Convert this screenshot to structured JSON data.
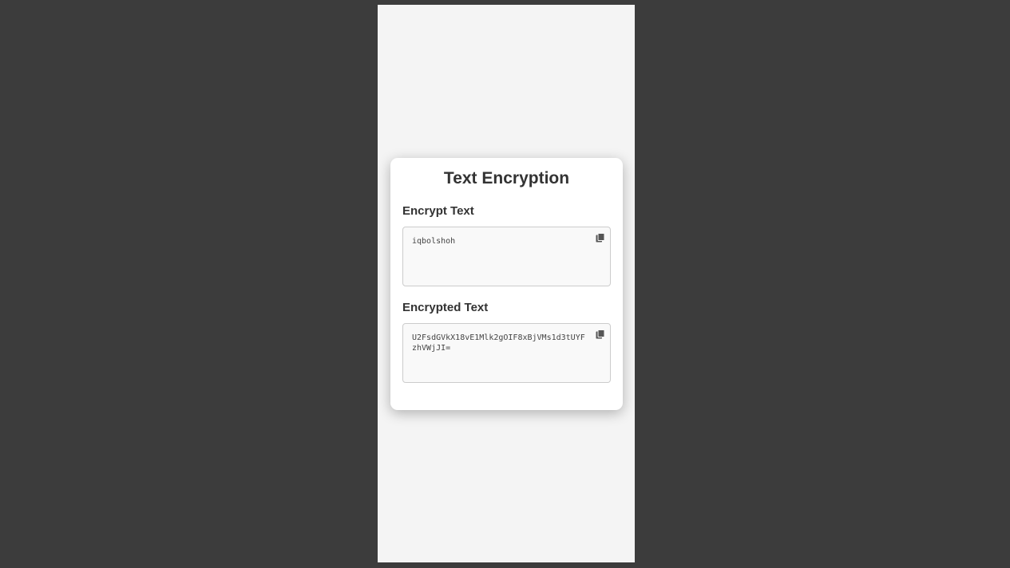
{
  "app": {
    "title": "Text Encryption"
  },
  "encrypt_section": {
    "label": "Encrypt Text",
    "input_value": "iqbolshoh",
    "copy_icon": "copy-icon"
  },
  "encrypted_section": {
    "label": "Encrypted Text",
    "output_value": "U2FsdGVkX18vE1Mlk2gOIF8xBjVMs1d3tUYFzhVWjJI=",
    "copy_icon": "copy-icon"
  },
  "colors": {
    "page_background": "#3c3c3c",
    "viewport_background": "#f4f4f4",
    "card_background": "#ffffff",
    "text": "#333333",
    "field_background": "#f9f9f9",
    "field_border": "#cccccc",
    "icon": "#555555"
  }
}
